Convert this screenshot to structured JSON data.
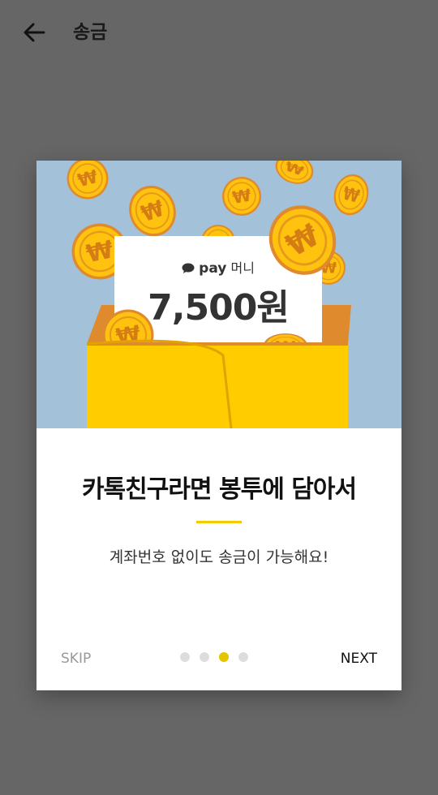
{
  "header": {
    "title": "송금",
    "back_icon": "arrow-left-icon"
  },
  "hero": {
    "brand_name": "pay",
    "brand_suffix": "머니",
    "amount": "7,500원",
    "brand_icon": "speech-bubble-icon",
    "coin_symbol": "₩"
  },
  "content": {
    "headline": "카톡친구라면 봉투에 담아서",
    "subtext": "계좌번호 없이도 송금이 가능해요!"
  },
  "footer": {
    "skip_label": "SKIP",
    "next_label": "NEXT",
    "pages_total": 4,
    "current_page": 3
  },
  "colors": {
    "overlay": "#666666",
    "hero_background": "#a3c2d9",
    "envelope": "#ffcc00",
    "envelope_flap": "#e08a2e",
    "coin": "#ffc20e",
    "accent": "#f2cc00"
  }
}
